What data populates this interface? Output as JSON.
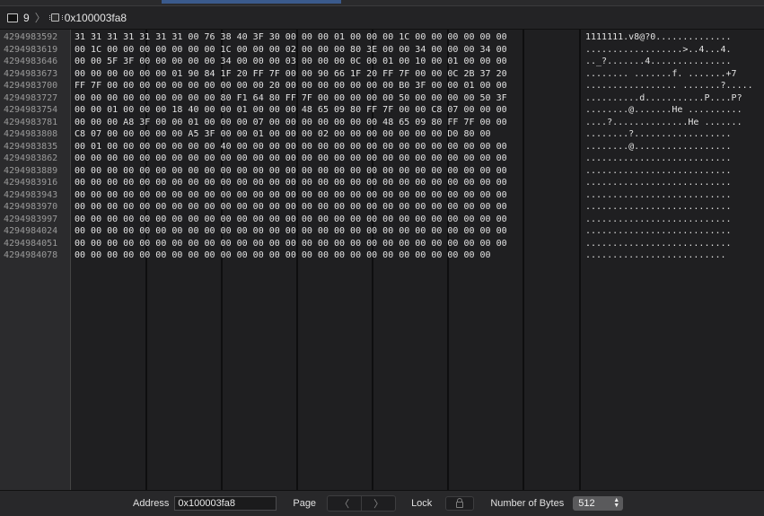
{
  "breadcrumb": {
    "items": [
      {
        "label": "9",
        "icon": "terminal-icon"
      },
      {
        "label": "0x100003fa8",
        "icon": "memory-chip-icon"
      }
    ],
    "separator": "〉"
  },
  "memory": {
    "addresses": [
      "4294983592",
      "4294983619",
      "4294983646",
      "4294983673",
      "4294983700",
      "4294983727",
      "4294983754",
      "4294983781",
      "4294983808",
      "4294983835",
      "4294983862",
      "4294983889",
      "4294983916",
      "4294983943",
      "4294983970",
      "4294983997",
      "4294984024",
      "4294984051",
      "4294984078"
    ],
    "hex_rows": [
      "31 31 31 31 31 31 31 00 76 38 40 3F 30 00 00 00 01 00 00 00 1C 00 00 00 00 00 00",
      "00 1C 00 00 00 00 00 00 00 1C 00 00 00 02 00 00 00 80 3E 00 00 34 00 00 00 34 00",
      "00 00 5F 3F 00 00 00 00 00 34 00 00 00 03 00 00 00 0C 00 01 00 10 00 01 00 00 00",
      "00 00 00 00 00 00 01 90 84 1F 20 FF 7F 00 00 90 66 1F 20 FF 7F 00 00 0C 2B 37 20",
      "FF 7F 00 00 00 00 00 00 00 00 00 00 20 00 00 00 00 00 00 00 B0 3F 00 00 01 00 00",
      "00 00 00 00 00 00 00 00 00 80 F1 64 80 FF 7F 00 00 00 00 00 50 00 00 00 00 50 3F",
      "00 00 01 00 00 00 18 40 00 00 01 00 00 00 48 65 09 80 FF 7F 00 00 C8 07 00 00 00",
      "00 00 00 A8 3F 00 00 01 00 00 00 07 00 00 00 00 00 00 00 48 65 09 80 FF 7F 00 00",
      "C8 07 00 00 00 00 00 A5 3F 00 00 01 00 00 00 02 00 00 00 00 00 00 00 D0 80 00",
      "00 01 00 00 00 00 00 00 00 40 00 00 00 00 00 00 00 00 00 00 00 00 00 00 00 00 00",
      "00 00 00 00 00 00 00 00 00 00 00 00 00 00 00 00 00 00 00 00 00 00 00 00 00 00 00",
      "00 00 00 00 00 00 00 00 00 00 00 00 00 00 00 00 00 00 00 00 00 00 00 00 00 00 00",
      "00 00 00 00 00 00 00 00 00 00 00 00 00 00 00 00 00 00 00 00 00 00 00 00 00 00 00",
      "00 00 00 00 00 00 00 00 00 00 00 00 00 00 00 00 00 00 00 00 00 00 00 00 00 00 00",
      "00 00 00 00 00 00 00 00 00 00 00 00 00 00 00 00 00 00 00 00 00 00 00 00 00 00 00",
      "00 00 00 00 00 00 00 00 00 00 00 00 00 00 00 00 00 00 00 00 00 00 00 00 00 00 00",
      "00 00 00 00 00 00 00 00 00 00 00 00 00 00 00 00 00 00 00 00 00 00 00 00 00 00 00",
      "00 00 00 00 00 00 00 00 00 00 00 00 00 00 00 00 00 00 00 00 00 00 00 00 00 00 00",
      "00 00 00 00 00 00 00 00 00 00 00 00 00 00 00 00 00 00 00 00 00 00 00 00 00 00"
    ],
    "ascii_rows": [
      "1111111.v8@?0..............",
      "..................>..4...4.",
      ".._?.......4...............",
      "........ .......f. .......+7",
      "................. .......?.....",
      "..........d...........P....P?",
      "........@.......He ..........",
      "....?..............He .......",
      "........?..................",
      "........@..................",
      "...........................",
      "...........................",
      "...........................",
      "...........................",
      "...........................",
      "...........................",
      "...........................",
      "...........................",
      ".........................."
    ]
  },
  "bottom": {
    "address_label": "Address",
    "address_value": "0x100003fa8",
    "page_label": "Page",
    "page_prev": "〈",
    "page_next": "〉",
    "lock_label": "Lock",
    "bytes_label": "Number of Bytes",
    "bytes_value": "512"
  }
}
